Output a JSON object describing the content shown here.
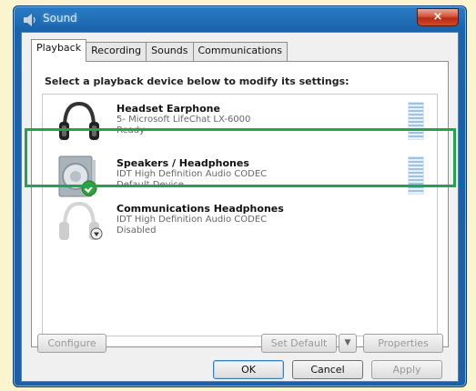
{
  "window": {
    "title": "Sound",
    "close_label": "×"
  },
  "tabs": [
    {
      "label": "Playback",
      "active": true
    },
    {
      "label": "Recording"
    },
    {
      "label": "Sounds"
    },
    {
      "label": "Communications"
    }
  ],
  "playback": {
    "instruction": "Select a playback device below to modify its settings:",
    "devices": [
      {
        "name": "Headset Earphone",
        "description": "5- Microsoft LifeChat LX-6000",
        "status": "Ready",
        "icon": "headset-icon"
      },
      {
        "name": "Speakers / Headphones",
        "description": "IDT High Definition Audio CODEC",
        "status": "Default Device",
        "icon": "speaker-icon",
        "badge": "default-check-icon",
        "selected": true
      },
      {
        "name": "Communications Headphones",
        "description": "IDT High Definition Audio CODEC",
        "status": "Disabled",
        "icon": "headphones-icon",
        "badge": "disabled-down-arrow-icon"
      }
    ],
    "highlight_color": "#21a352"
  },
  "buttons": {
    "configure": "Configure",
    "set_default": "Set Default",
    "set_default_arrow": "▼",
    "properties": "Properties",
    "ok": "OK",
    "cancel": "Cancel",
    "apply": "Apply"
  }
}
